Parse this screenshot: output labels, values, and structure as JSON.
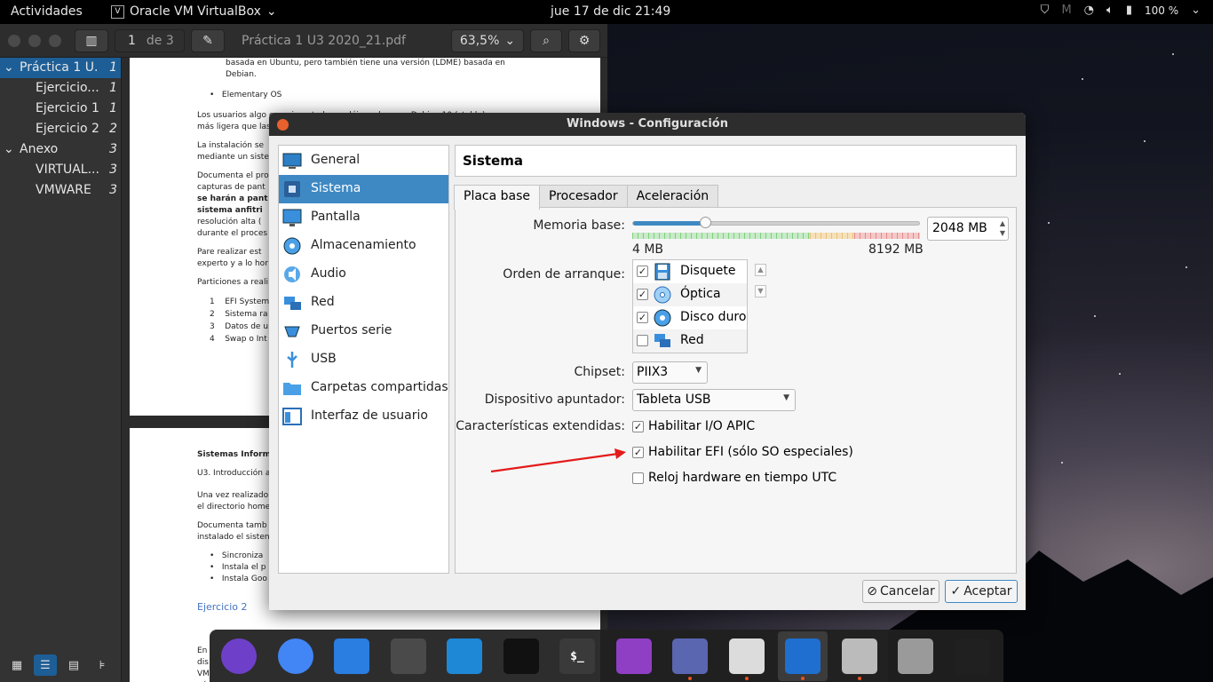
{
  "topbar": {
    "activities": "Actividades",
    "app_name": "Oracle VM VirtualBox",
    "clock": "jue 17 de dic  21:49",
    "battery": "100 %"
  },
  "viewer": {
    "page_current": "1",
    "page_total": "de 3",
    "doc_title": "Práctica 1 U3 2020_21.pdf",
    "zoom": "63,5%",
    "outline": [
      {
        "label": "Práctica 1 U...",
        "num": "1",
        "level": 0,
        "expanded": true,
        "selected": true
      },
      {
        "label": "Ejercicio...",
        "num": "1",
        "level": 1
      },
      {
        "label": "Ejercicio 1",
        "num": "1",
        "level": 1
      },
      {
        "label": "Ejercicio 2",
        "num": "2",
        "level": 1
      },
      {
        "label": "Anexo",
        "num": "3",
        "level": 0,
        "expanded": true
      },
      {
        "label": "VIRTUAL...",
        "num": "3",
        "level": 1
      },
      {
        "label": "VMWARE",
        "num": "3",
        "level": 1
      }
    ],
    "page1": {
      "line1": "basada en Ubuntu, pero también tiene una versión (LDME) basada en",
      "line2": "Debian.",
      "bullet": "Elementary OS",
      "p1a": "Los usuarios algo experimentados podéis probar con Debian 10 (stable) que es",
      "p1b": "más ligera que las",
      "p2a": "La instalación se",
      "p2b": "mediante un siste",
      "p3a": "Documenta el pro",
      "p3b": "capturas de pant",
      "p3c": "se harán a pant",
      "p3d": "sistema anfitri",
      "p3e": "resolución alta (",
      "p3f": "durante el proces",
      "p4a": "Pare realizar est",
      "p4b": "experto y a lo hor",
      "p5": "Particiones a reali",
      "list": [
        "EFI System",
        "Sistema ra",
        "Datos de u",
        "Swap o Int"
      ]
    },
    "page2": {
      "h": "Sistemas Inform",
      "sub": "U3. Introducción a",
      "p1a": "Una vez realizado",
      "p1b": "el directorio home",
      "p2a": "Documenta tamb",
      "p2b": "instalado el sisten",
      "bullets": [
        "Sincroniza",
        "Instala el p",
        "Instala Goo"
      ],
      "link": "Ejercicio 2",
      "tail": [
        "En",
        "dis",
        "VM",
        "aú"
      ]
    }
  },
  "dialog": {
    "title": "Windows - Configuración",
    "section_title": "Sistema",
    "categories": [
      {
        "label": "General",
        "icon": "general-icon"
      },
      {
        "label": "Sistema",
        "icon": "system-icon",
        "selected": true
      },
      {
        "label": "Pantalla",
        "icon": "display-icon"
      },
      {
        "label": "Almacenamiento",
        "icon": "storage-icon"
      },
      {
        "label": "Audio",
        "icon": "audio-icon"
      },
      {
        "label": "Red",
        "icon": "network-icon"
      },
      {
        "label": "Puertos serie",
        "icon": "serial-ports-icon"
      },
      {
        "label": "USB",
        "icon": "usb-icon"
      },
      {
        "label": "Carpetas compartidas",
        "icon": "shared-folders-icon"
      },
      {
        "label": "Interfaz de usuario",
        "icon": "user-interface-icon"
      }
    ],
    "tabs": [
      "Placa base",
      "Procesador",
      "Aceleración"
    ],
    "memory": {
      "label": "Memoria base:",
      "value": "2048 MB",
      "min_label": "4 MB",
      "max_label": "8192 MB",
      "fraction": 0.25
    },
    "boot": {
      "label": "Orden de arranque:",
      "items": [
        {
          "label": "Disquete",
          "checked": true,
          "icon": "floppy-icon"
        },
        {
          "label": "Óptica",
          "checked": true,
          "icon": "optical-disc-icon"
        },
        {
          "label": "Disco duro",
          "checked": true,
          "icon": "hard-disk-icon"
        },
        {
          "label": "Red",
          "checked": false,
          "icon": "network-boot-icon"
        }
      ]
    },
    "chipset": {
      "label": "Chipset:",
      "value": "PIIX3"
    },
    "pointing": {
      "label": "Dispositivo apuntador:",
      "value": "Tableta USB"
    },
    "extended": {
      "label": "Características extendidas:",
      "options": [
        {
          "label": "Habilitar I/O APIC",
          "checked": true
        },
        {
          "label": "Habilitar EFI (sólo SO especiales)",
          "checked": true
        },
        {
          "label": "Reloj hardware en tiempo UTC",
          "checked": false
        }
      ]
    },
    "buttons": {
      "cancel": "Cancelar",
      "ok": "Aceptar"
    }
  },
  "dock": {
    "apps": [
      {
        "name": "github-desktop-icon",
        "color": "#6e40c9"
      },
      {
        "name": "chrome-icon",
        "color": "#4285f4"
      },
      {
        "name": "text-editor-icon",
        "color": "#2a7de1"
      },
      {
        "name": "settings-app-icon",
        "color": "#4a4a4a"
      },
      {
        "name": "vscode-icon",
        "color": "#1e88d6"
      },
      {
        "name": "intellij-icon",
        "color": "#111111"
      },
      {
        "name": "terminal-icon",
        "color": "#3a3a3a",
        "text": "$_"
      },
      {
        "name": "tasks-icon",
        "color": "#8e3fc4"
      },
      {
        "name": "file-cabinet-icon",
        "color": "#5a66b0"
      },
      {
        "name": "document-viewer-icon",
        "color": "#dcdcdc"
      },
      {
        "name": "virtualbox-icon",
        "color": "#1e6fd0"
      },
      {
        "name": "disk-utility-icon",
        "color": "#bbbbbb"
      },
      {
        "name": "trash-icon",
        "color": "#9a9a9a"
      },
      {
        "name": "app-grid-icon",
        "color": "#202020"
      }
    ]
  }
}
